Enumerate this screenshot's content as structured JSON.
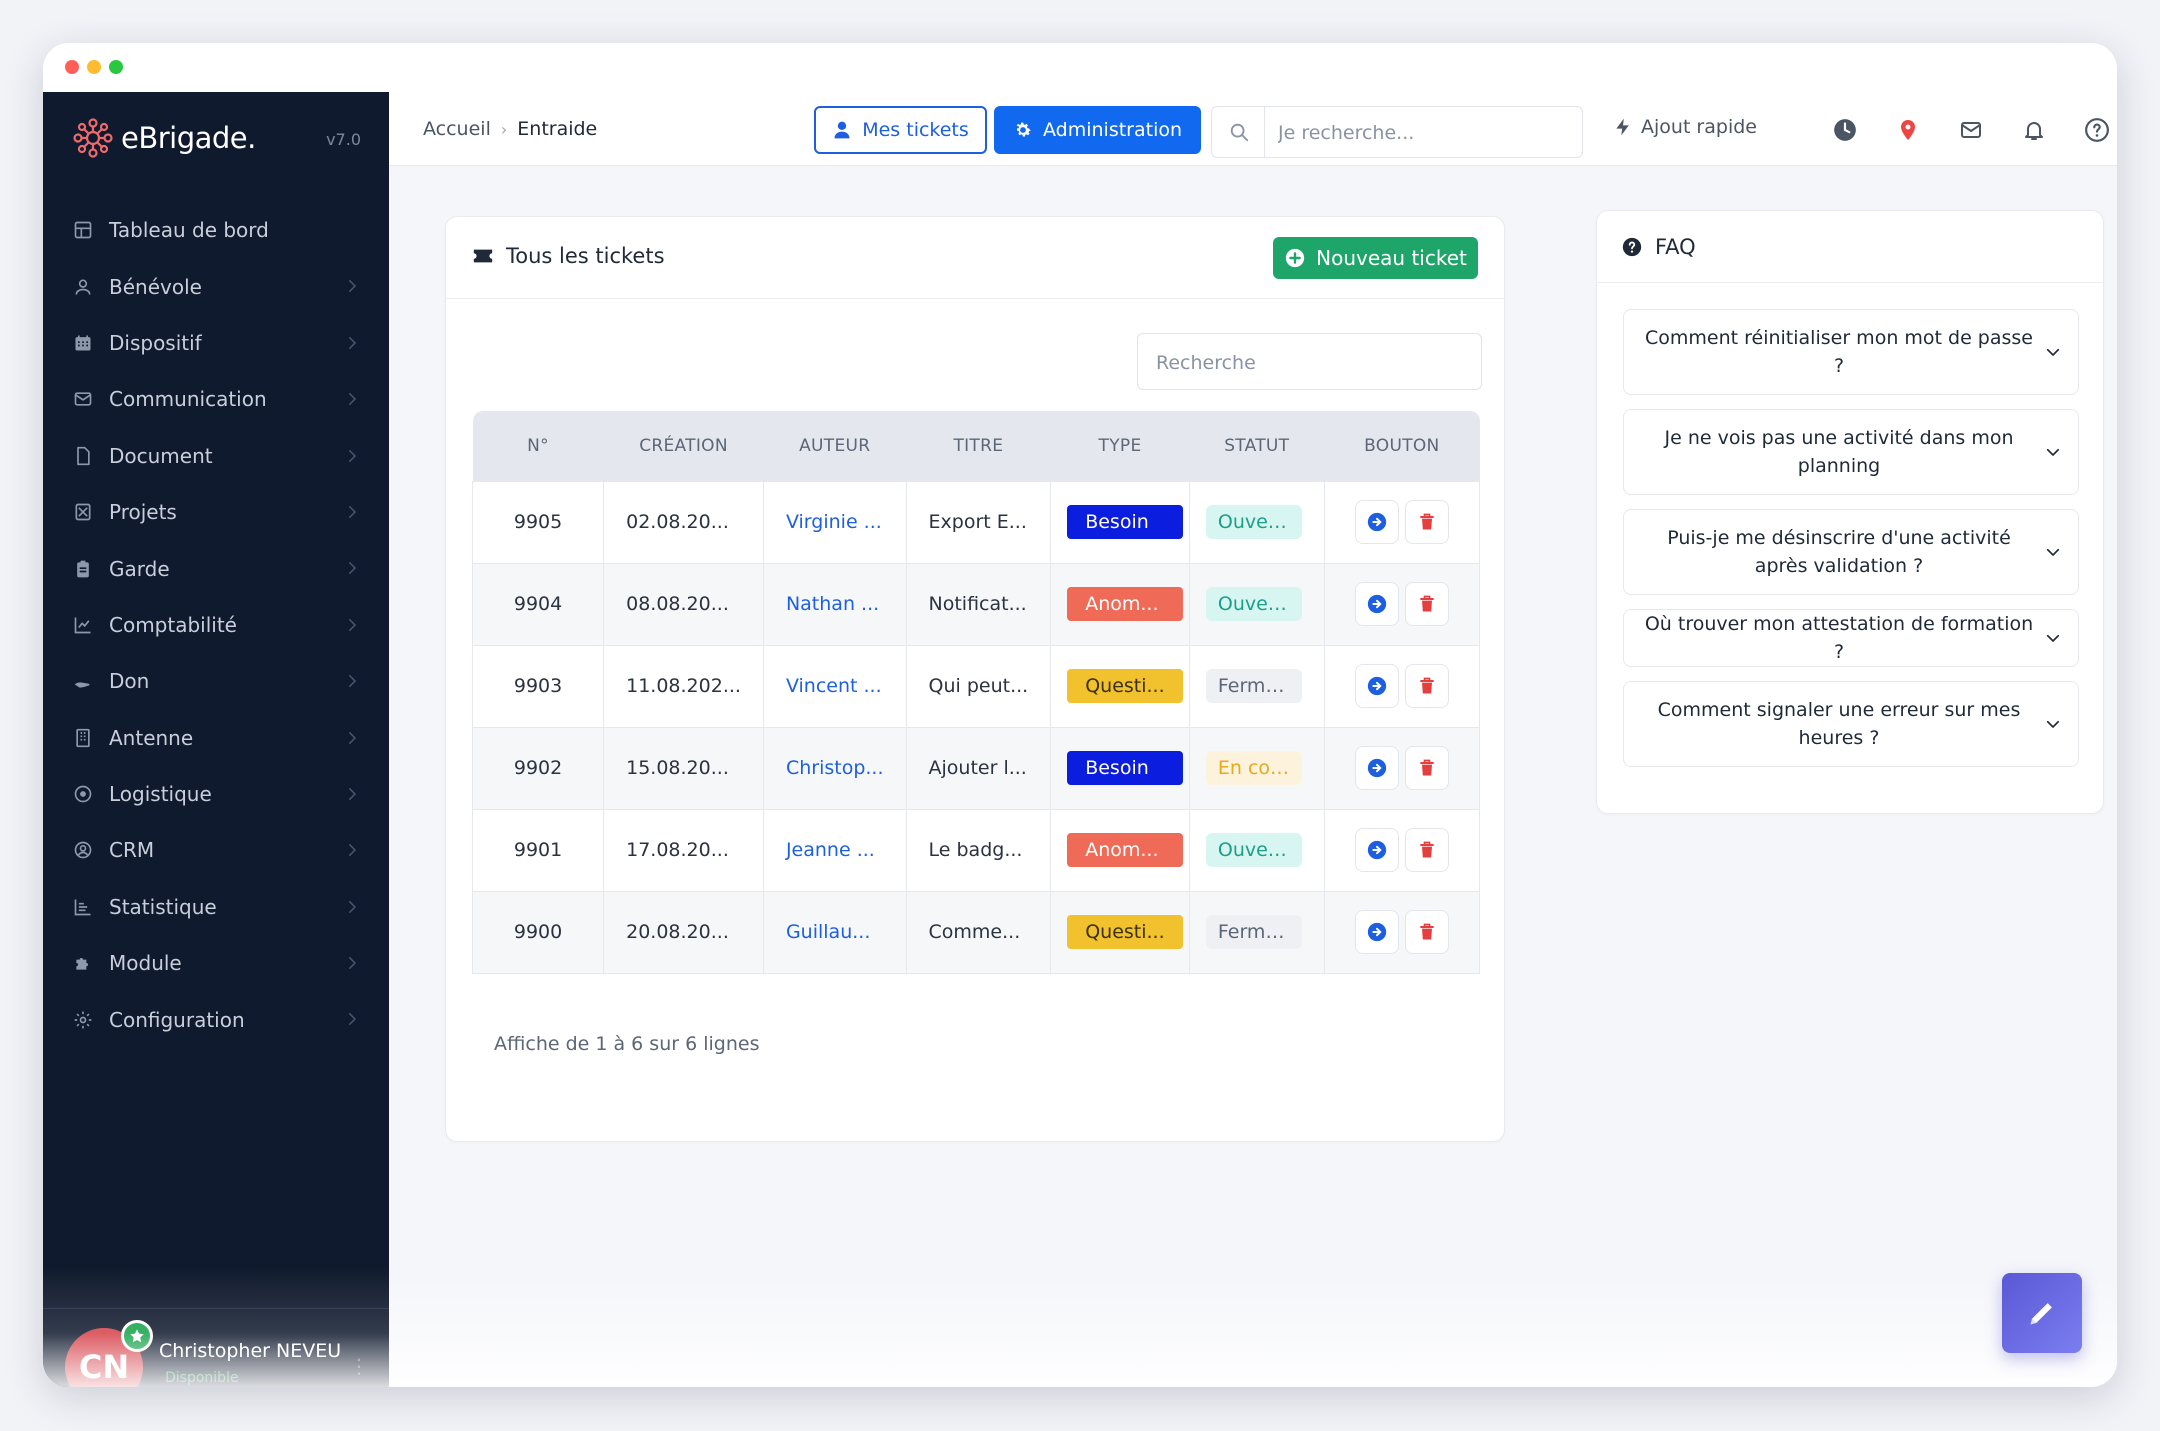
{
  "app": {
    "name": "eBrigade.",
    "version": "v7.0"
  },
  "sidebar": {
    "items": [
      {
        "label": "Tableau de bord",
        "icon": "dashboard-icon"
      },
      {
        "label": "Bénévole",
        "icon": "user-icon"
      },
      {
        "label": "Dispositif",
        "icon": "calendar-icon"
      },
      {
        "label": "Communication",
        "icon": "envelope-icon"
      },
      {
        "label": "Document",
        "icon": "file-icon"
      },
      {
        "label": "Projets",
        "icon": "project-icon"
      },
      {
        "label": "Garde",
        "icon": "clipboard-icon"
      },
      {
        "label": "Comptabilité",
        "icon": "chart-line-icon"
      },
      {
        "label": "Don",
        "icon": "hand-icon"
      },
      {
        "label": "Antenne",
        "icon": "building-icon"
      },
      {
        "label": "Logistique",
        "icon": "target-icon"
      },
      {
        "label": "CRM",
        "icon": "user-circle-icon"
      },
      {
        "label": "Statistique",
        "icon": "stats-icon"
      },
      {
        "label": "Module",
        "icon": "puzzle-icon"
      },
      {
        "label": "Configuration",
        "icon": "gear-icon"
      }
    ],
    "user": {
      "initials": "CN",
      "name": "Christopher NEVEU",
      "status": "Disponible"
    }
  },
  "topbar": {
    "breadcrumb": {
      "home": "Accueil",
      "separator": "›",
      "current": "Entraide"
    },
    "my_tickets": "Mes tickets",
    "administration": "Administration",
    "search_placeholder": "Je recherche...",
    "quick_add": "Ajout rapide"
  },
  "tickets": {
    "title": "Tous les tickets",
    "new_button": "Nouveau ticket",
    "search_placeholder": "Recherche",
    "columns": [
      "N°",
      "CRÉATION",
      "AUTEUR",
      "TITRE",
      "TYPE",
      "STATUT",
      "BOUTON"
    ],
    "rows": [
      {
        "num": "9905",
        "date": "02.08.20...",
        "author": "Virginie ...",
        "title": "Export E...",
        "type": "Besoin",
        "type_bg": "#0b1ee0",
        "type_fg": "#ffffff",
        "status": "Ouvert...",
        "status_bg": "#d8f6f1",
        "status_fg": "#1b9e8a"
      },
      {
        "num": "9904",
        "date": "08.08.20...",
        "author": "Nathan ...",
        "title": "Notificat...",
        "type": "Anom...",
        "type_bg": "#ef6b57",
        "type_fg": "#ffffff",
        "status": "Ouvert...",
        "status_bg": "#d8f6f1",
        "status_fg": "#1b9e8a"
      },
      {
        "num": "9903",
        "date": "11.08.202...",
        "author": "Vincent ...",
        "title": "Qui peut...",
        "type": "Questi...",
        "type_bg": "#f2c12e",
        "type_fg": "#3b3006",
        "status": "Fermé...",
        "status_bg": "#eef0f3",
        "status_fg": "#5b6677"
      },
      {
        "num": "9902",
        "date": "15.08.20...",
        "author": "Christop...",
        "title": "Ajouter l...",
        "type": "Besoin",
        "type_bg": "#0b1ee0",
        "type_fg": "#ffffff",
        "status": "En cou...",
        "status_bg": "#fdf3dc",
        "status_fg": "#e6a91c"
      },
      {
        "num": "9901",
        "date": "17.08.20...",
        "author": "Jeanne ...",
        "title": "Le badg...",
        "type": "Anom...",
        "type_bg": "#ef6b57",
        "type_fg": "#ffffff",
        "status": "Ouvert...",
        "status_bg": "#d8f6f1",
        "status_fg": "#1b9e8a"
      },
      {
        "num": "9900",
        "date": "20.08.20...",
        "author": "Guillau...",
        "title": "Comme...",
        "type": "Questi...",
        "type_bg": "#f2c12e",
        "type_fg": "#3b3006",
        "status": "Fermé...",
        "status_bg": "#eef0f3",
        "status_fg": "#5b6677"
      }
    ],
    "footer": "Affiche de 1 à 6 sur 6 lignes"
  },
  "faq": {
    "title": "FAQ",
    "items": [
      "Comment réinitialiser mon mot de passe ?",
      "Je ne vois pas une activité dans mon planning",
      "Puis-je me désinscrire d'une activité après validation ?",
      "Où trouver mon attestation de formation ?",
      "Comment signaler une erreur sur mes heures ?"
    ]
  },
  "colors": {
    "sidebar_bg": "#101a2e",
    "primary": "#1169f0",
    "success": "#1ea66a",
    "danger": "#e53e3e",
    "fab": "#6a6ae6"
  }
}
